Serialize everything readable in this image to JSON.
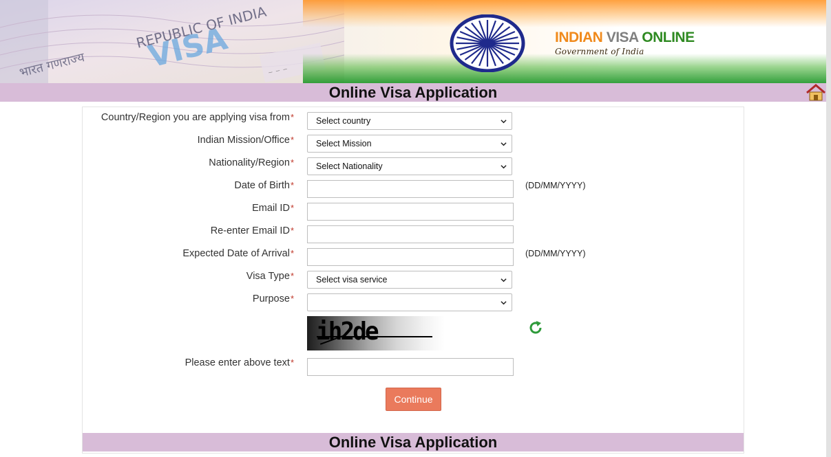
{
  "header": {
    "brand_word1": "INDIAN",
    "brand_word2": "VISA",
    "brand_word3": "ONLINE",
    "brand_sub": "Government of India",
    "visa_art_text": [
      "REPUBLIC OF INDIA",
      "VISA",
      "भारत गणराज्य"
    ]
  },
  "title": "Online Visa Application",
  "form": {
    "country": {
      "label": "Country/Region you are applying visa from",
      "value": "Select country"
    },
    "mission": {
      "label": "Indian Mission/Office",
      "value": "Select Mission"
    },
    "nationality": {
      "label": "Nationality/Region",
      "value": "Select Nationality"
    },
    "dob": {
      "label": "Date of Birth",
      "value": "",
      "hint": "(DD/MM/YYYY)"
    },
    "email": {
      "label": "Email ID",
      "value": ""
    },
    "email_confirm": {
      "label": "Re-enter Email ID",
      "value": ""
    },
    "arrival": {
      "label": "Expected Date of Arrival",
      "value": "",
      "hint": "(DD/MM/YYYY)"
    },
    "visa_type": {
      "label": "Visa Type",
      "value": "Select visa service"
    },
    "purpose": {
      "label": "Purpose",
      "value": ""
    },
    "captcha_text": "ih2de",
    "captcha_input": {
      "label": "Please enter above text",
      "value": ""
    },
    "required_marker": "*",
    "continue_label": "Continue"
  },
  "footer_title": "Online Visa Application",
  "icons": {
    "home": "home-icon",
    "refresh": "refresh-icon",
    "dropdown": "chevron-down-icon",
    "emblem": "ashoka-chakra-icon"
  },
  "colors": {
    "strip_bg": "#d8bcd8",
    "button_bg": "#ea7a5c",
    "required": "#c0392b",
    "saffron": "#f08a1c",
    "green": "#2f8a22",
    "chakra_blue": "#1f2a8c"
  }
}
